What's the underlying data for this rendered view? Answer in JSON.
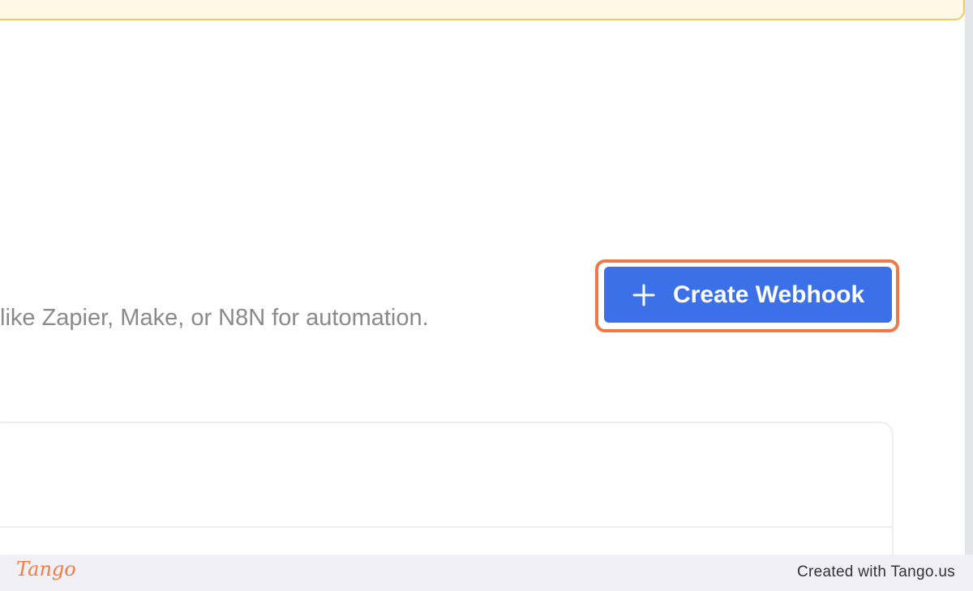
{
  "banner": {},
  "description": {
    "text": "like Zapier, Make, or N8N for automation."
  },
  "actions": {
    "create_webhook_label": "Create Webhook",
    "create_webhook_icon": "plus-icon"
  },
  "footer": {
    "logo_text": "Tango",
    "credit_text": "Created with Tango.us"
  },
  "colors": {
    "primary_button": "#3c70e8",
    "highlight": "#f07a47",
    "banner_bg": "#fff8e6",
    "banner_border": "#f5c75e",
    "footer_bg": "#f1f0f6",
    "tango_brand": "#ef7d45"
  }
}
